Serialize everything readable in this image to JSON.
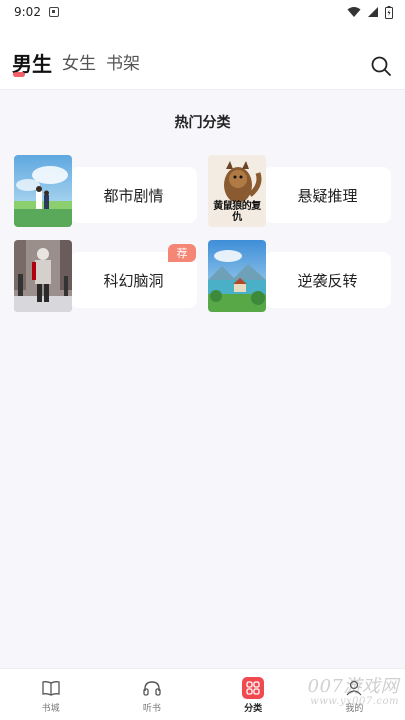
{
  "status_bar": {
    "time": "9:02"
  },
  "tabs": [
    {
      "label": "男生",
      "active": true
    },
    {
      "label": "女生",
      "active": false
    },
    {
      "label": "书架",
      "active": false
    }
  ],
  "section": {
    "title": "热门分类"
  },
  "categories": [
    {
      "label": "都市剧情",
      "badge": ""
    },
    {
      "label": "悬疑推理",
      "badge": ""
    },
    {
      "label": "科幻脑洞",
      "badge": "荐"
    },
    {
      "label": "逆袭反转",
      "badge": ""
    }
  ],
  "cover_texts": {
    "mystery_cover": "黄鼠狼的复仇"
  },
  "bottom_nav": [
    {
      "label": "书城",
      "icon": "book-icon",
      "active": false
    },
    {
      "label": "听书",
      "icon": "headphones-icon",
      "active": false
    },
    {
      "label": "分类",
      "icon": "grid-icon",
      "active": true
    },
    {
      "label": "我的",
      "icon": "user-icon",
      "active": false
    }
  ],
  "watermark": {
    "text": "007游戏网",
    "url": "www.yx007.com"
  },
  "colors": {
    "accent": "#ef4a50",
    "badge": "#f58574",
    "background": "#f6f6fb"
  }
}
